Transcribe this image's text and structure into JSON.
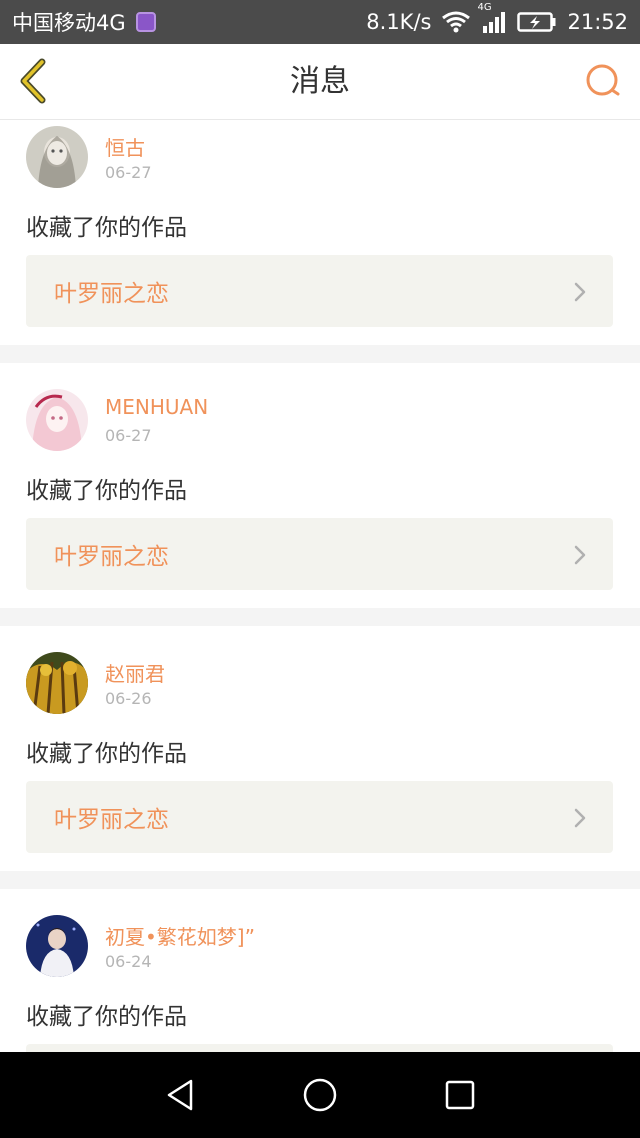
{
  "statusbar": {
    "carrier": "中国移动4G",
    "speed": "8.1K/s",
    "network": "4G",
    "time": "21:52"
  },
  "header": {
    "title": "消息"
  },
  "messages": [
    {
      "username": "恒古",
      "date": "06-27",
      "action": "收藏了你的作品",
      "work": "叶罗丽之恋"
    },
    {
      "username": "MENHUAN",
      "date": "06-27",
      "action": "收藏了你的作品",
      "work": "叶罗丽之恋"
    },
    {
      "username": "赵丽君",
      "date": "06-26",
      "action": "收藏了你的作品",
      "work": "叶罗丽之恋"
    },
    {
      "username": "初夏•繁花如梦]”",
      "date": "06-24",
      "action": "收藏了你的作品",
      "work": ""
    }
  ],
  "colors": {
    "accent": "#f0925a",
    "back_arrow": "#e1c32b",
    "card_bg": "#f3f3ee"
  }
}
